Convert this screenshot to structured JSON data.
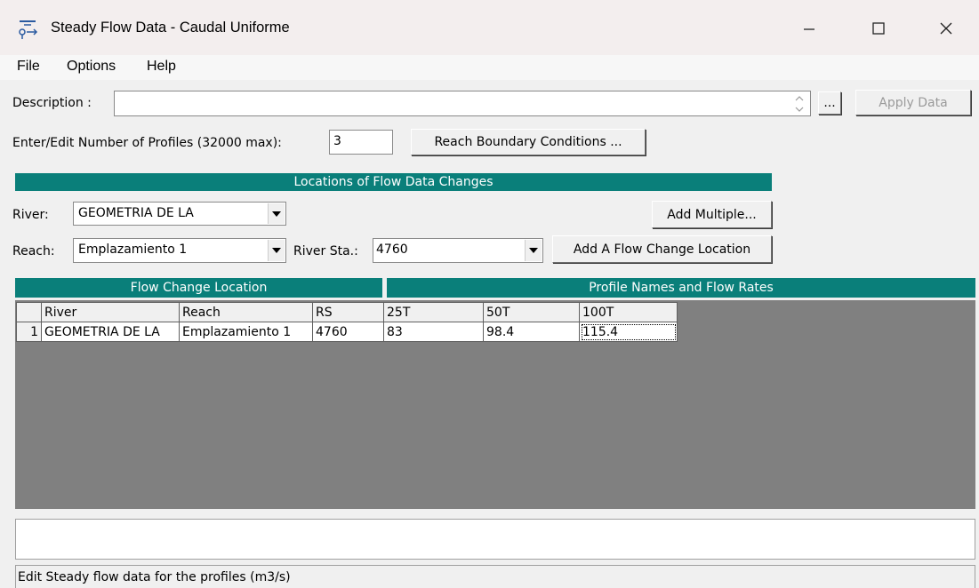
{
  "window": {
    "title": "Steady Flow Data - Caudal Uniforme",
    "icon": "flow-data-icon",
    "controls": [
      "minimize-icon",
      "maximize-icon",
      "close-icon"
    ]
  },
  "menu": {
    "items": [
      "File",
      "Options",
      "Help"
    ]
  },
  "description": {
    "label": "Description :",
    "value": "",
    "browse_label": "...",
    "apply_label": "Apply Data"
  },
  "profiles": {
    "label": "Enter/Edit Number of Profiles (32000 max):",
    "value": "3",
    "reach_bc_label": "Reach Boundary Conditions ..."
  },
  "locations": {
    "header": "Locations of Flow Data Changes",
    "river_label": "River:",
    "river_value": "GEOMETRIA DE LA",
    "reach_label": "Reach:",
    "reach_value": "Emplazamiento 1",
    "river_sta_label": "River Sta.:",
    "river_sta_value": "4760",
    "add_multiple_label": "Add Multiple...",
    "add_flow_change_label": "Add A Flow Change Location"
  },
  "table": {
    "flow_change_header": "Flow Change Location",
    "profile_header": "Profile Names and Flow Rates",
    "columns": [
      "River",
      "Reach",
      "RS",
      "25T",
      "50T",
      "100T"
    ],
    "rows": [
      {
        "index": "1",
        "river": "GEOMETRIA DE LA",
        "reach": "Emplazamiento 1",
        "rs": "4760",
        "v25": "83",
        "v50": "98.4",
        "v100": "115.4"
      }
    ]
  },
  "status": {
    "text": "Edit Steady flow data for the profiles (m3/s)"
  },
  "colors": {
    "header_teal": "#0a7f7a",
    "grid_gray": "#808080"
  }
}
